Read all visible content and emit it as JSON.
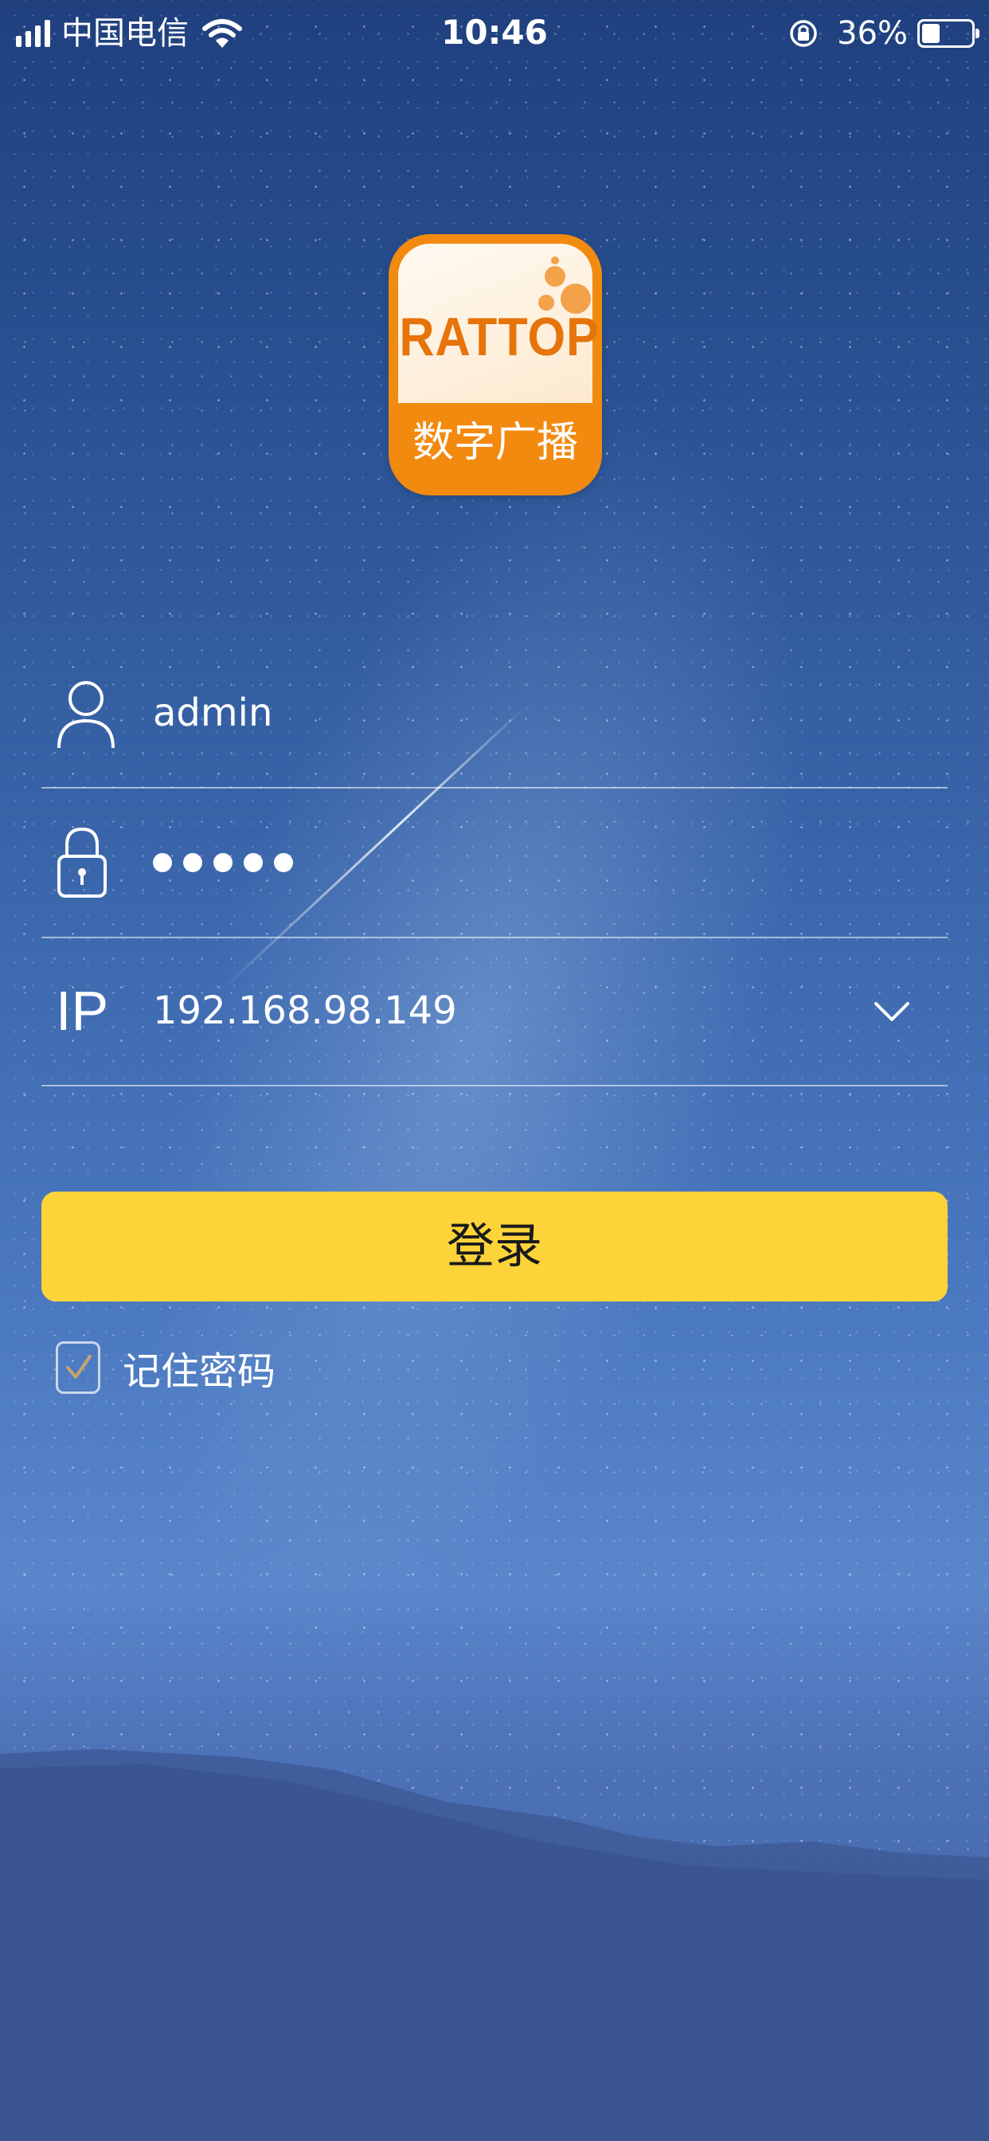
{
  "status_bar": {
    "carrier": "中国电信",
    "time": "10:46",
    "battery_percent": "36%",
    "battery_level": 0.36
  },
  "logo": {
    "brand": "RATTOP",
    "subtitle": "数字广播",
    "colors": {
      "orange": "#f28a10",
      "cream": "#fde9cf"
    }
  },
  "form": {
    "username": {
      "value": "admin",
      "icon": "user-icon"
    },
    "password": {
      "masked_length": 5,
      "icon": "lock-icon"
    },
    "ip": {
      "label": "IP",
      "value": "192.168.98.149",
      "dropdown_icon": "chevron-down-icon"
    }
  },
  "login_button": {
    "label": "登录",
    "color": "#fcd43a"
  },
  "remember": {
    "label": "记住密码",
    "checked": true
  }
}
